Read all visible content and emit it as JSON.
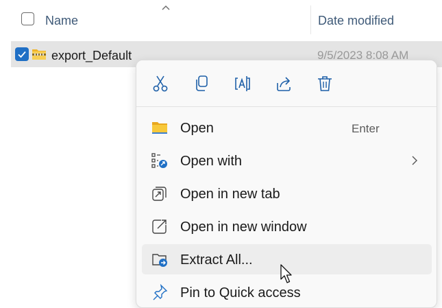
{
  "file_list": {
    "columns": {
      "name": "Name",
      "date_modified": "Date modified"
    },
    "sort": "ascending"
  },
  "selected_file": {
    "name": "export_Default",
    "date_modified": "9/5/2023 8:08 AM",
    "checked": true
  },
  "context_menu": {
    "toolbar": [
      {
        "id": "cut",
        "icon": "scissors-icon"
      },
      {
        "id": "copy",
        "icon": "copy-icon"
      },
      {
        "id": "rename",
        "icon": "rename-icon"
      },
      {
        "id": "share",
        "icon": "share-icon"
      },
      {
        "id": "delete",
        "icon": "trash-icon"
      }
    ],
    "items": [
      {
        "label": "Open",
        "accelerator": "Enter",
        "icon": "folder-icon"
      },
      {
        "label": "Open with",
        "submenu": true,
        "icon": "open-with-icon"
      },
      {
        "label": "Open in new tab",
        "icon": "new-tab-icon"
      },
      {
        "label": "Open in new window",
        "icon": "new-window-icon"
      },
      {
        "label": "Extract All...",
        "icon": "extract-icon",
        "hovered": true
      },
      {
        "label": "Pin to Quick access",
        "icon": "pin-icon"
      }
    ]
  },
  "colors": {
    "accent": "#1f6fc5",
    "folder": "#f5c53a",
    "menu_bg": "#f9f9f9",
    "row_selected": "#e4e4e4"
  }
}
